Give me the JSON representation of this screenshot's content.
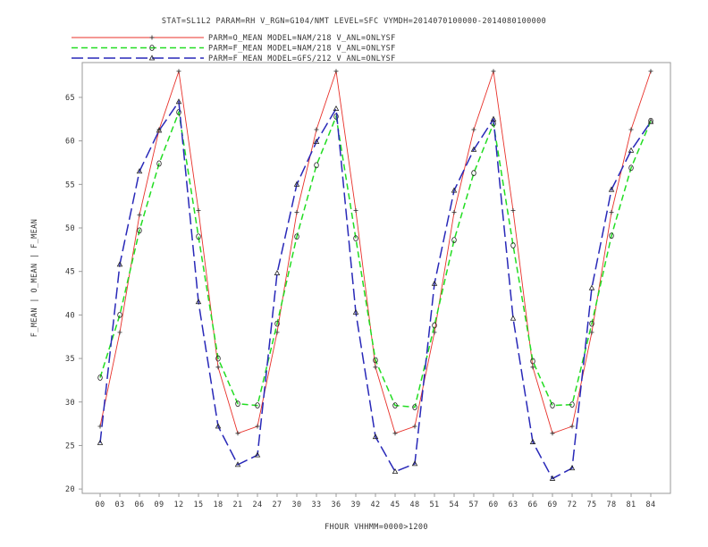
{
  "chart_data": {
    "type": "line",
    "title": "STAT=SL1L2 PARAM=RH V_RGN=G104/NMT LEVEL=SFC VYMDH=2014070100000-2014080100000",
    "xlabel": "FHOUR VHHMM=0000>1200",
    "ylabel": "F_MEAN | O_MEAN | F_MEAN",
    "categories": [
      "00",
      "03",
      "06",
      "09",
      "12",
      "15",
      "18",
      "21",
      "24",
      "27",
      "30",
      "33",
      "36",
      "39",
      "42",
      "45",
      "48",
      "51",
      "54",
      "57",
      "60",
      "63",
      "66",
      "69",
      "72",
      "75",
      "78",
      "81",
      "84"
    ],
    "ylim": [
      19.5,
      69
    ],
    "yticks": [
      20,
      25,
      30,
      35,
      40,
      45,
      50,
      55,
      60,
      65
    ],
    "grid": false,
    "legend_position": "top-left",
    "series": [
      {
        "name": "PARM=O_MEAN MODEL=NAM/218 V_ANL=ONLYSF",
        "color": "#e8312a",
        "dash": "solid",
        "marker": "plus",
        "values": [
          27.2,
          38.0,
          51.5,
          61.3,
          68.0,
          52.0,
          34.0,
          26.4,
          27.2,
          38.0,
          51.8,
          61.3,
          68.0,
          52.0,
          34.0,
          26.4,
          27.2,
          38.0,
          51.8,
          61.3,
          68.0,
          52.0,
          34.0,
          26.4,
          27.2,
          38.0,
          51.8,
          61.3,
          68.0
        ]
      },
      {
        "name": "PARM=F_MEAN MODEL=NAM/218 V_ANL=ONLYSF",
        "color": "#22dd22",
        "dash": "dashed",
        "marker": "diamond",
        "values": [
          32.8,
          40.0,
          49.7,
          57.4,
          63.3,
          49.0,
          35.0,
          29.8,
          29.6,
          39.0,
          49.0,
          57.2,
          62.8,
          48.8,
          34.8,
          29.6,
          29.4,
          38.8,
          48.6,
          56.3,
          62.0,
          48.0,
          34.7,
          29.6,
          29.7,
          39.0,
          49.1,
          56.9,
          62.3
        ]
      },
      {
        "name": "PARM=F_MEAN MODEL=GFS/212 V_ANL=ONLYSF",
        "color": "#2828b8",
        "dash": "longdash",
        "marker": "triangle",
        "values": [
          25.3,
          45.8,
          56.5,
          61.2,
          64.5,
          41.5,
          27.2,
          22.8,
          23.9,
          44.8,
          55.0,
          59.9,
          63.7,
          40.3,
          26.0,
          22.0,
          22.9,
          43.6,
          54.3,
          59.0,
          62.5,
          39.6,
          25.4,
          21.2,
          22.4,
          43.1,
          54.4,
          58.9,
          62.2
        ]
      }
    ]
  }
}
